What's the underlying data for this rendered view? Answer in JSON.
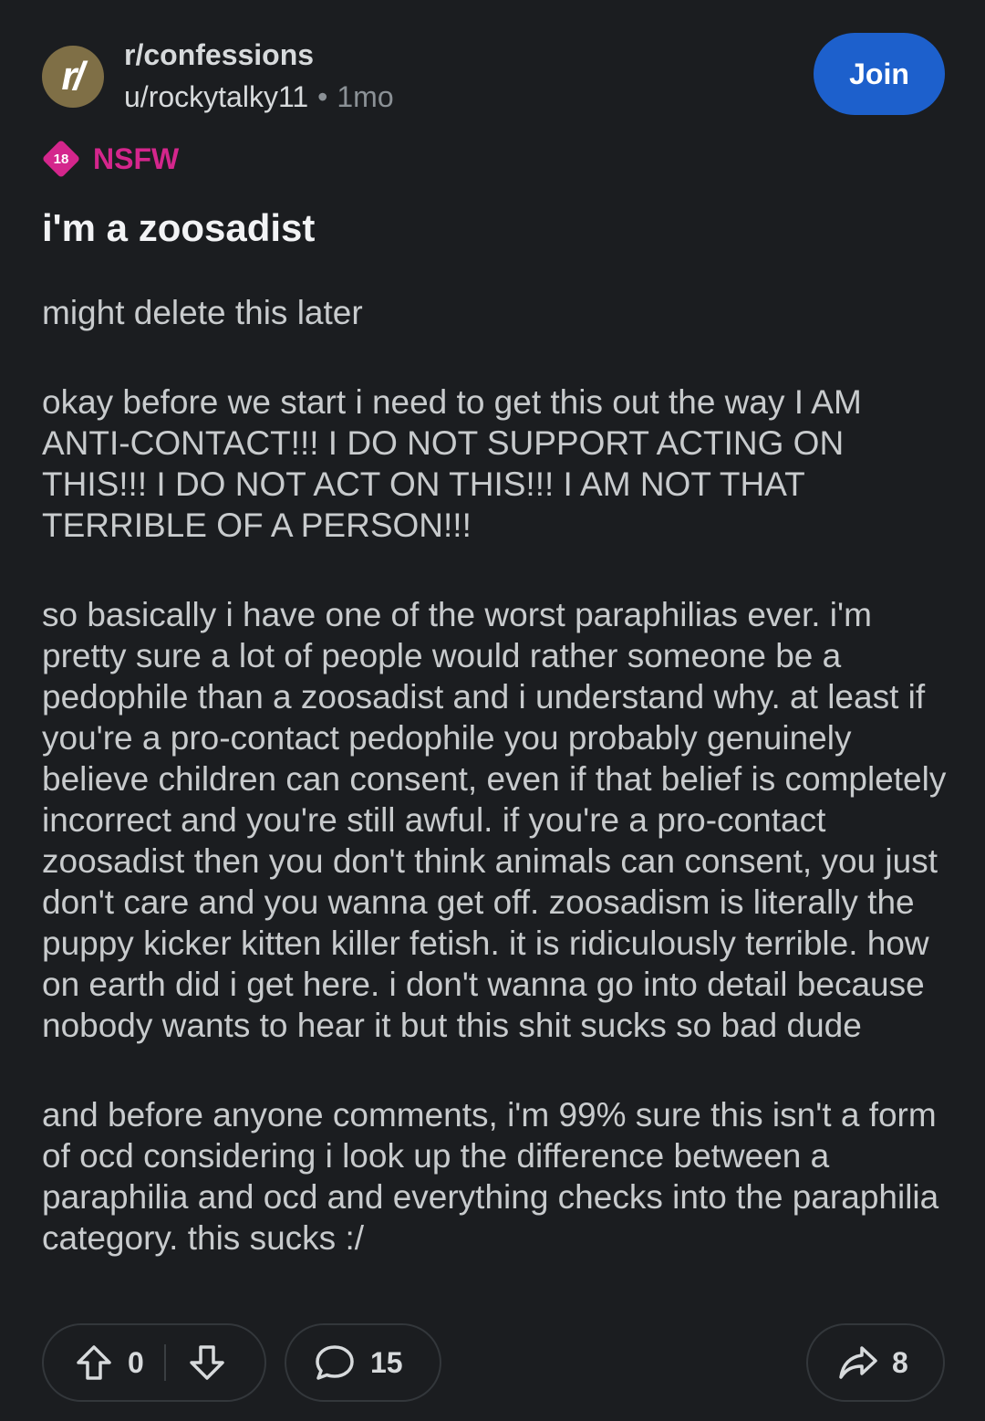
{
  "header": {
    "avatar_text": "r/",
    "subreddit": "r/confessions",
    "username": "u/rockytalky11",
    "separator": "•",
    "age": "1mo",
    "join_label": "Join"
  },
  "badge": {
    "age_number": "18",
    "label": "NSFW",
    "color": "#d4268c"
  },
  "post": {
    "title": "i'm a zoosadist",
    "paragraphs": [
      "might delete this later",
      "okay before we start i need to get this out the way I AM ANTI-CONTACT!!! I DO NOT SUPPORT ACTING ON THIS!!! I DO NOT ACT ON THIS!!! I AM NOT THAT TERRIBLE OF A PERSON!!!",
      "so basically i have one of the worst paraphilias ever. i'm pretty sure a lot of people would rather someone be a pedophile than a zoosadist and i understand why. at least if you're a pro-contact pedophile you probably genuinely believe children can consent, even if that belief is completely incorrect and you're still awful. if you're a pro-contact zoosadist then you don't think animals can consent, you just don't care and you wanna get off. zoosadism is literally the puppy kicker kitten killer fetish. it is ridiculously terrible. how on earth did i get here. i don't wanna go into detail because nobody wants to hear it but this shit sucks so bad dude",
      "and before anyone comments, i'm 99% sure this isn't a form of ocd considering i look up the difference between a paraphilia and ocd and everything checks into the paraphilia category. this sucks :/"
    ]
  },
  "actions": {
    "vote_count": "0",
    "comment_count": "15",
    "share_count": "8",
    "icons": {
      "upvote": "upvote-arrow-icon",
      "downvote": "downvote-arrow-icon",
      "comment": "speech-bubble-icon",
      "share": "share-arrow-icon"
    }
  },
  "colors": {
    "background": "#1b1d20",
    "join_button": "#1d60cc",
    "avatar": "#7f6f46"
  }
}
